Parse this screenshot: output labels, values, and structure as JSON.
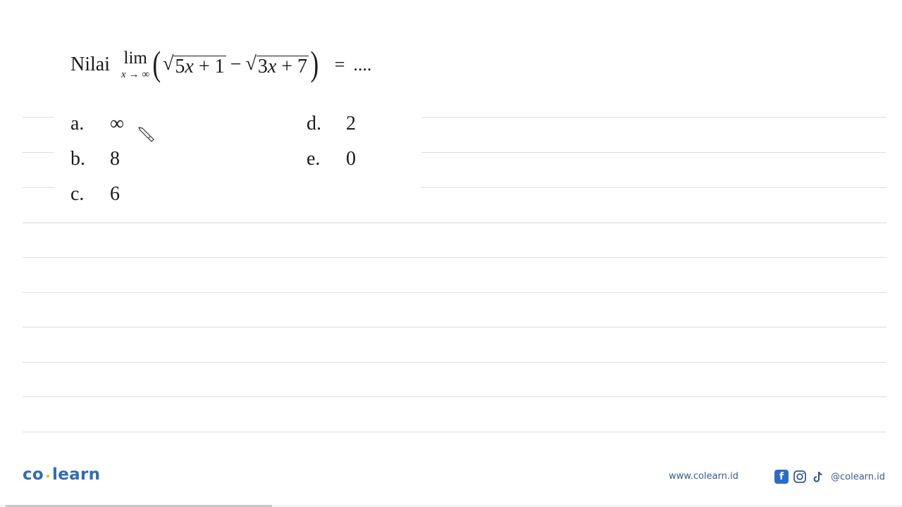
{
  "question": {
    "label": "Nilai",
    "limit_word": "lim",
    "limit_variable": "x",
    "limit_arrow": "→",
    "limit_target": "∞",
    "open_paren": "(",
    "close_paren": ")",
    "radicand_1": {
      "coef": "5",
      "var": "x",
      "rest": " + 1"
    },
    "minus": "−",
    "radicand_2": {
      "coef": "3",
      "var": "x",
      "rest": " + 7"
    },
    "equals": "=",
    "ellipsis": "...."
  },
  "options": [
    {
      "letter": "a.",
      "value": "∞"
    },
    {
      "letter": "b.",
      "value": "8"
    },
    {
      "letter": "c.",
      "value": "6"
    },
    {
      "letter": "d.",
      "value": "2"
    },
    {
      "letter": "e.",
      "value": "0"
    }
  ],
  "footer": {
    "logo_left": "co",
    "logo_right": "learn",
    "website": "www.colearn.id",
    "social_handle": "@colearn.id",
    "facebook_glyph": "f"
  },
  "video_progress": 0.295,
  "colors": {
    "brand_blue": "#2f6cb4",
    "brand_yellow": "#f2c200",
    "rule_gray": "#dedede"
  }
}
